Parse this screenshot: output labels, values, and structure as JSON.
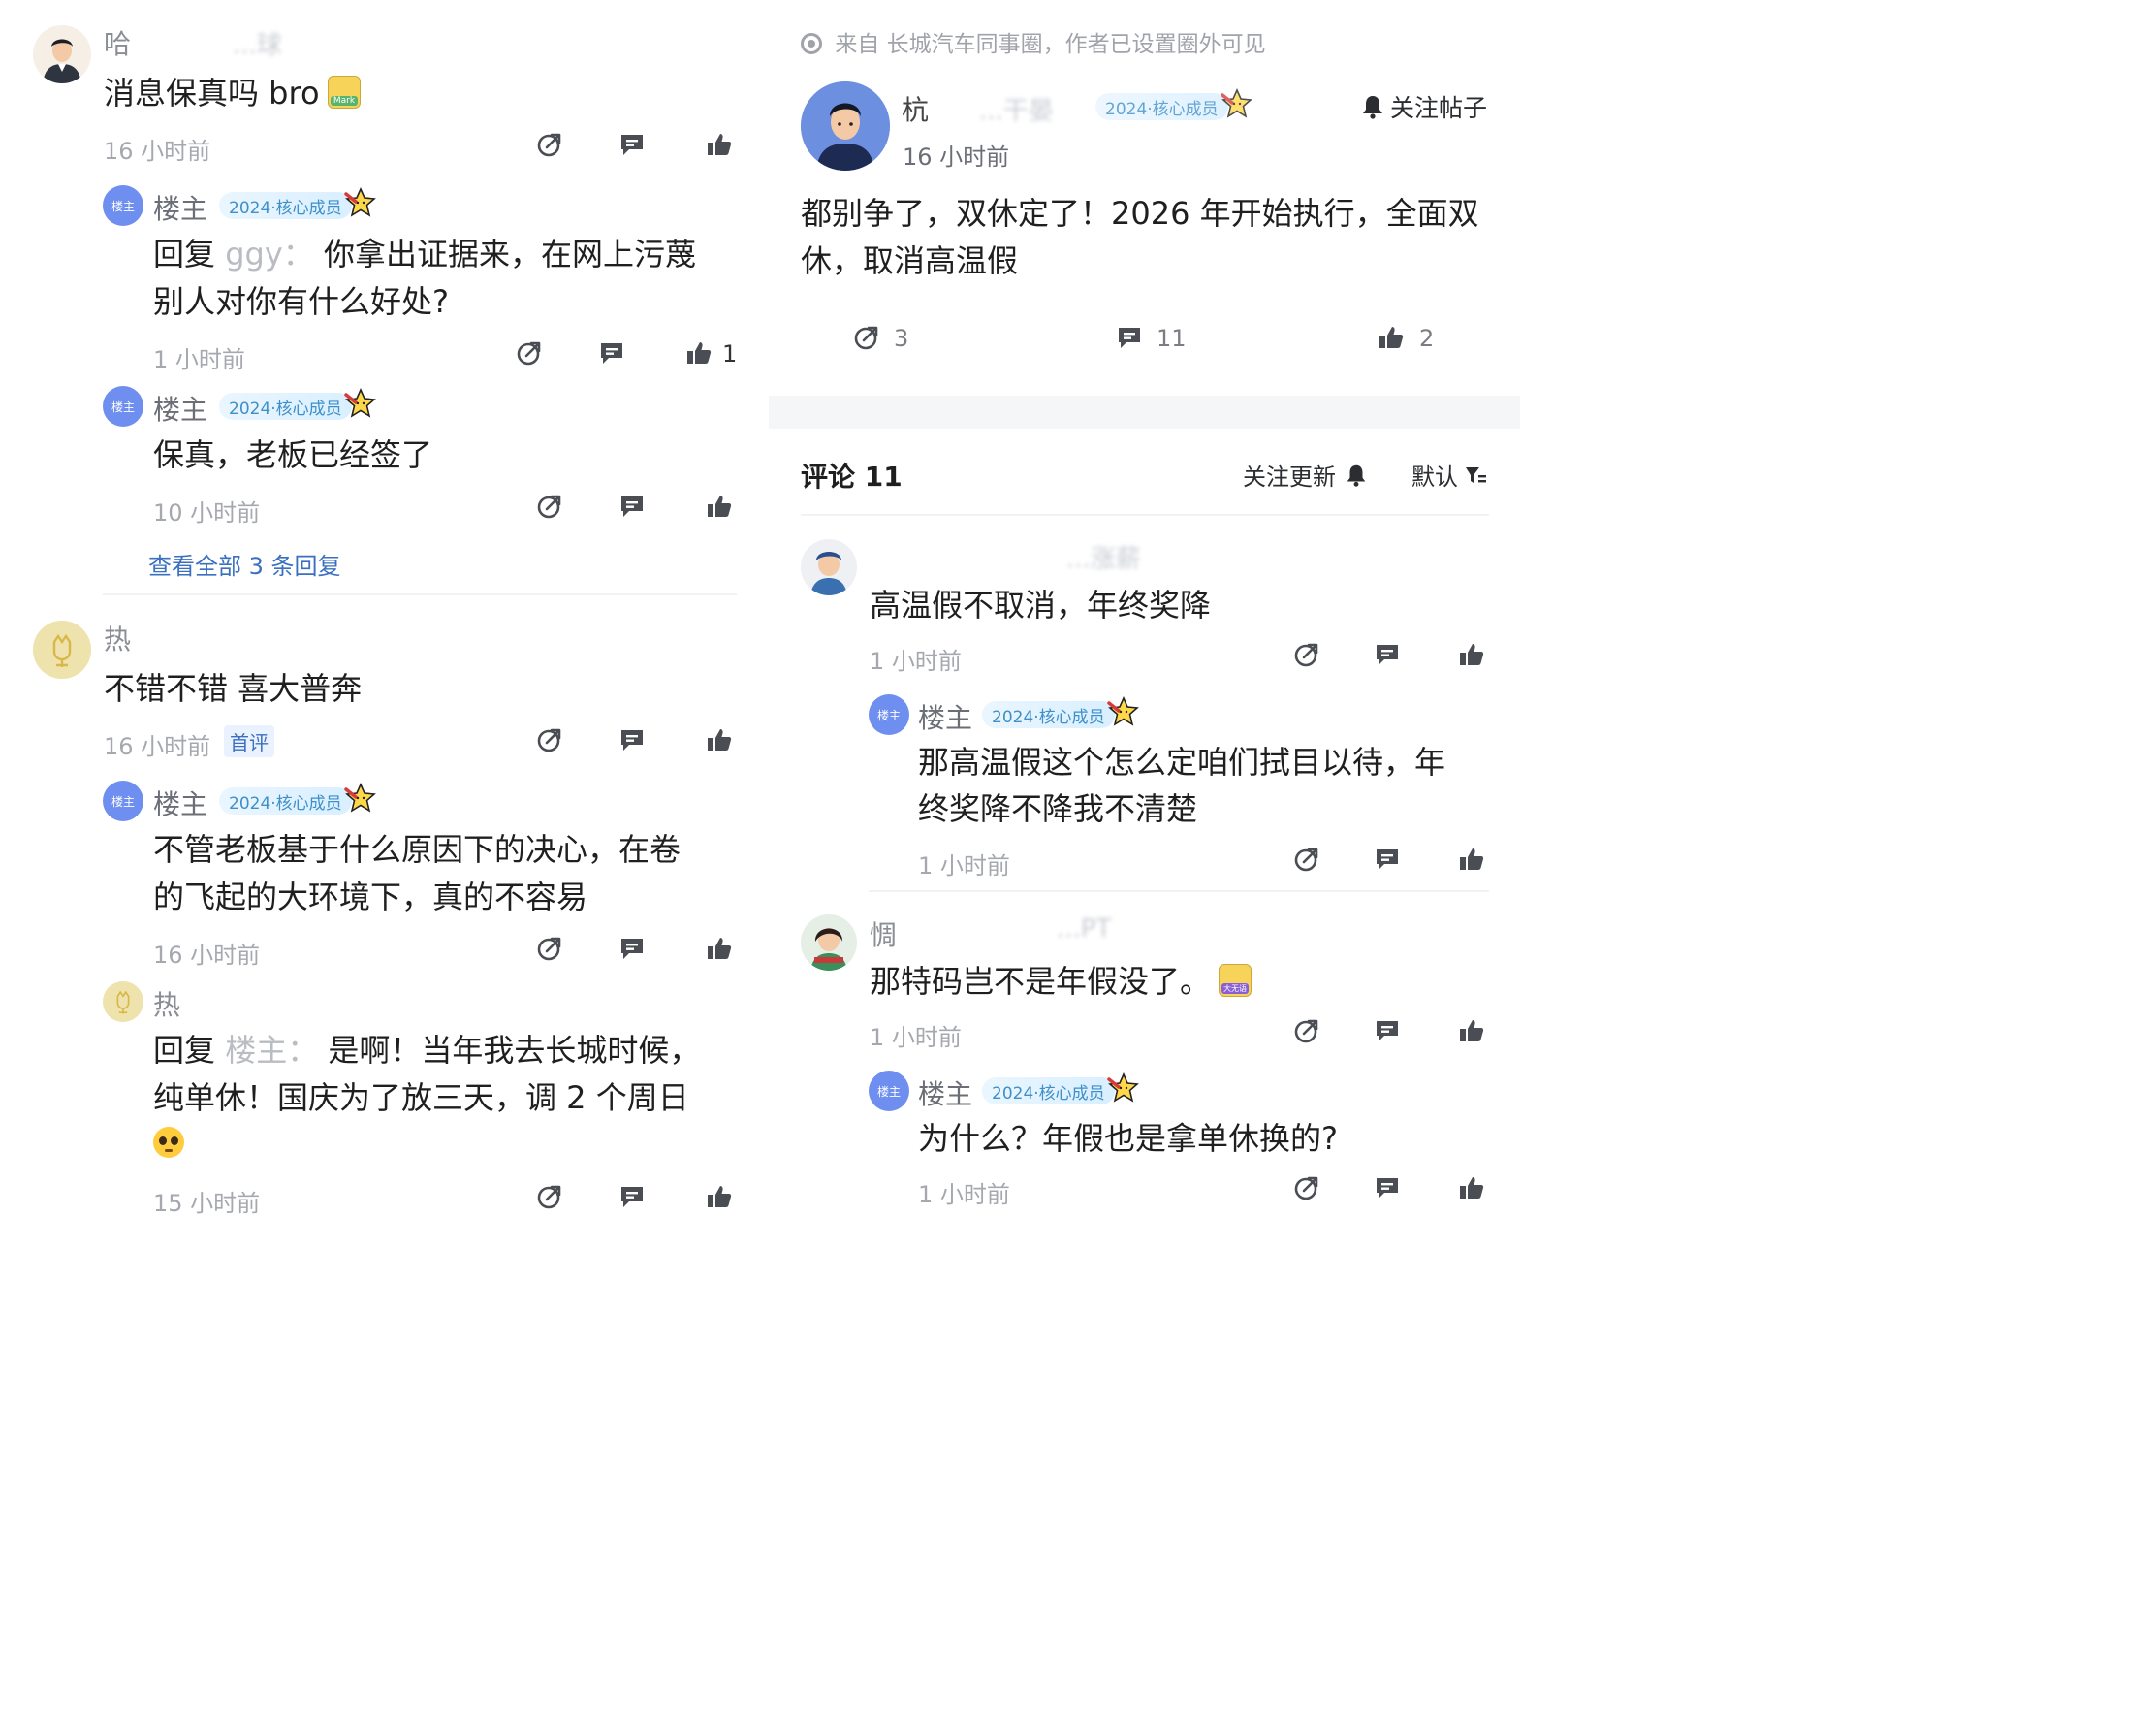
{
  "left": {
    "c1": {
      "name": "哈",
      "name_blur": "...球",
      "text": "消息保真吗 bro",
      "sticker_text": "Mark",
      "time": "16 小时前",
      "replies": [
        {
          "author": "楼主",
          "avatar_text": "楼主",
          "badge": "2024·核心成员",
          "line1_prefix": "回复",
          "line1_target": "ggy：",
          "line1_rest": "你拿出证据来，在网上污蔑",
          "line2": "别人对你有什么好处?",
          "time": "1 小时前",
          "likes": "1"
        },
        {
          "author": "楼主",
          "avatar_text": "楼主",
          "badge": "2024·核心成员",
          "line1": "保真，老板已经签了",
          "time": "10 小时前"
        }
      ],
      "view_all": "查看全部 3 条回复"
    },
    "c2": {
      "name": "热",
      "text": "不错不错 喜大普奔",
      "time": "16 小时前",
      "tag": "首评",
      "replies": [
        {
          "author": "楼主",
          "avatar_text": "楼主",
          "badge": "2024·核心成员",
          "line1": "不管老板基于什么原因下的决心，在卷",
          "line2": "的飞起的大环境下，真的不容易",
          "time": "16 小时前"
        },
        {
          "author": "热",
          "line1_prefix": "回复",
          "line1_target": "楼主：",
          "line1_rest": "是啊！当年我去长城时候，",
          "line2": "纯单休！国庆为了放三天，调 2 个周日",
          "time": "15 小时前"
        }
      ]
    }
  },
  "right": {
    "source": "来自 长城汽车同事圈，作者已设置圈外可见",
    "post": {
      "author": "杭",
      "author_blur": "...干晏",
      "badge": "2024·核心成员",
      "follow": "关注帖子",
      "time": "16 小时前",
      "line1": "都别争了，双休定了！2026 年开始执行，全面双",
      "line2": "休，取消高温假",
      "share_count": "3",
      "comment_count": "11",
      "like_count": "2"
    },
    "comments_header": {
      "title": "评论 11",
      "follow_updates": "关注更新",
      "sort": "默认"
    },
    "c1": {
      "name_blur": "...涨薪",
      "text": "高温假不取消，年终奖降",
      "time": "1 小时前",
      "reply": {
        "author": "楼主",
        "avatar_text": "楼主",
        "badge": "2024·核心成员",
        "line1": "那高温假这个怎么定咱们拭目以待，年",
        "line2": "终奖降不降我不清楚",
        "time": "1 小时前"
      }
    },
    "c2": {
      "name": "惆",
      "name_blur": "...PT",
      "text": "那特码岂不是年假没了。",
      "sticker_text": "大无语",
      "time": "1 小时前",
      "reply": {
        "author": "楼主",
        "avatar_text": "楼主",
        "badge": "2024·核心成员",
        "line1": "为什么？年假也是拿单休换的?",
        "time": "1 小时前"
      }
    }
  },
  "colors": {
    "host_avatar": "#6f8ff0",
    "badge_text": "#3f8fc9",
    "link": "#3b6fc0",
    "time": "#a5a8ae",
    "icon": "#4a4d54"
  }
}
